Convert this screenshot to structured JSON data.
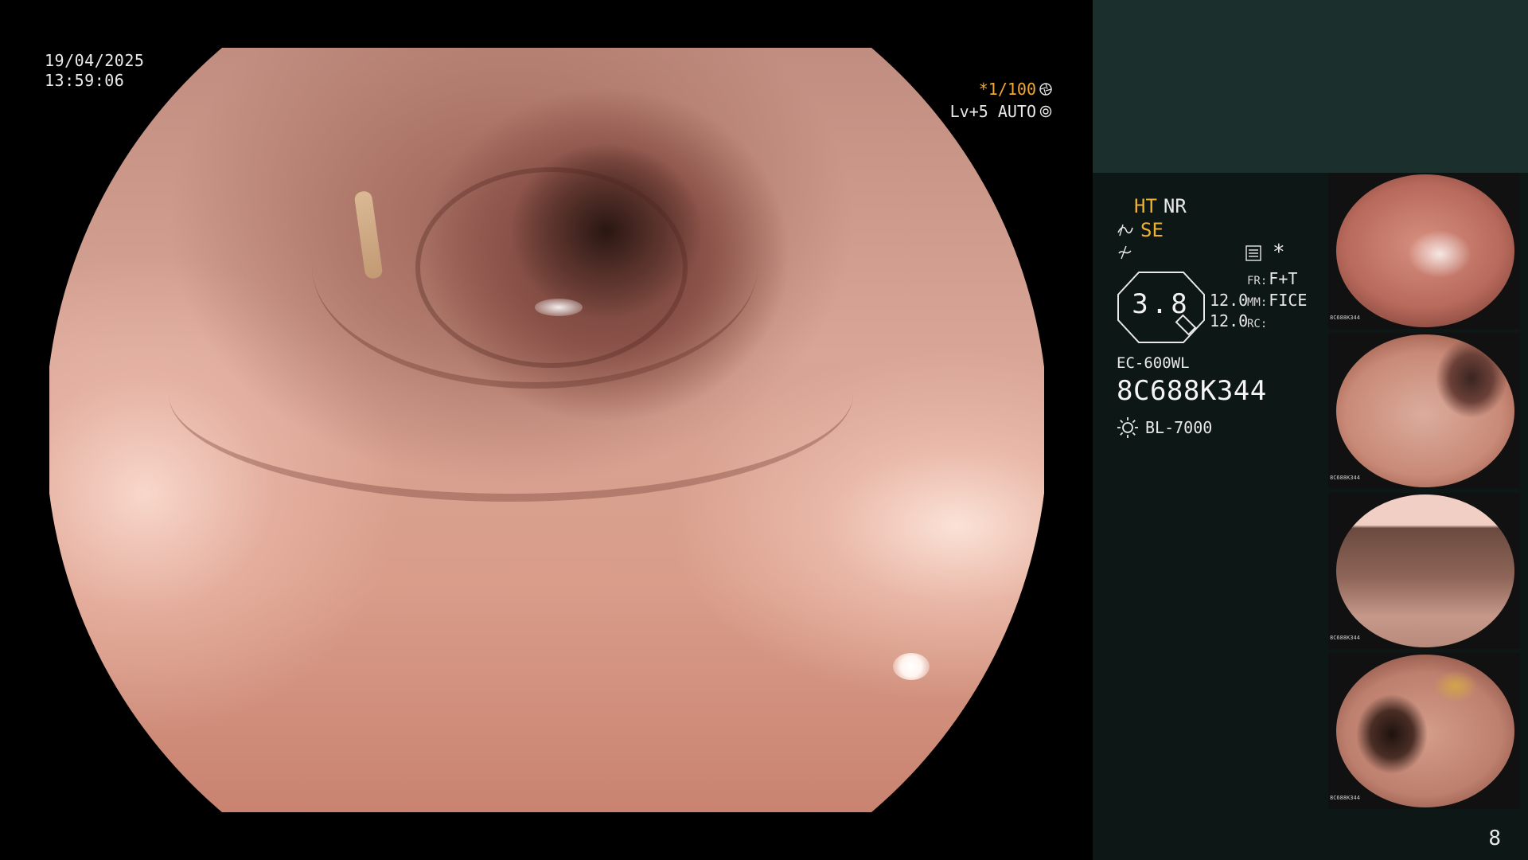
{
  "video": {
    "date": "19/04/2025",
    "time": "13:59:06",
    "shutter": "*1/100",
    "level": "Lv+5 AUTO"
  },
  "panel": {
    "ht": "HT",
    "nr": "NR",
    "se": "SE",
    "zoom": "3.8",
    "enhance_top": "12.0",
    "enhance_bottom": "12.0",
    "fr_label": "FR:",
    "fr_value": "F+T",
    "mm_label": "MM:",
    "mm_value": "FICE",
    "rc_label": "RC:",
    "rc_value": "",
    "model": "EC-600WL",
    "serial": "8C688K344",
    "light_source": "BL-7000"
  },
  "thumbnails": [
    {
      "label": "8C688K344"
    },
    {
      "label": "8C688K344"
    },
    {
      "label": "8C688K344"
    },
    {
      "label": "8C688K344"
    }
  ],
  "page_number": "8",
  "colors": {
    "accent_orange": "#f0b030",
    "panel_header": "#1b302d",
    "panel_bg": "#0d1715"
  },
  "icons": {
    "shutter": "aperture-icon",
    "level": "gear-icon",
    "se": "structure-enhance-icon",
    "color": "color-enhance-icon",
    "menu": "menu-icon",
    "light": "sun-icon"
  }
}
